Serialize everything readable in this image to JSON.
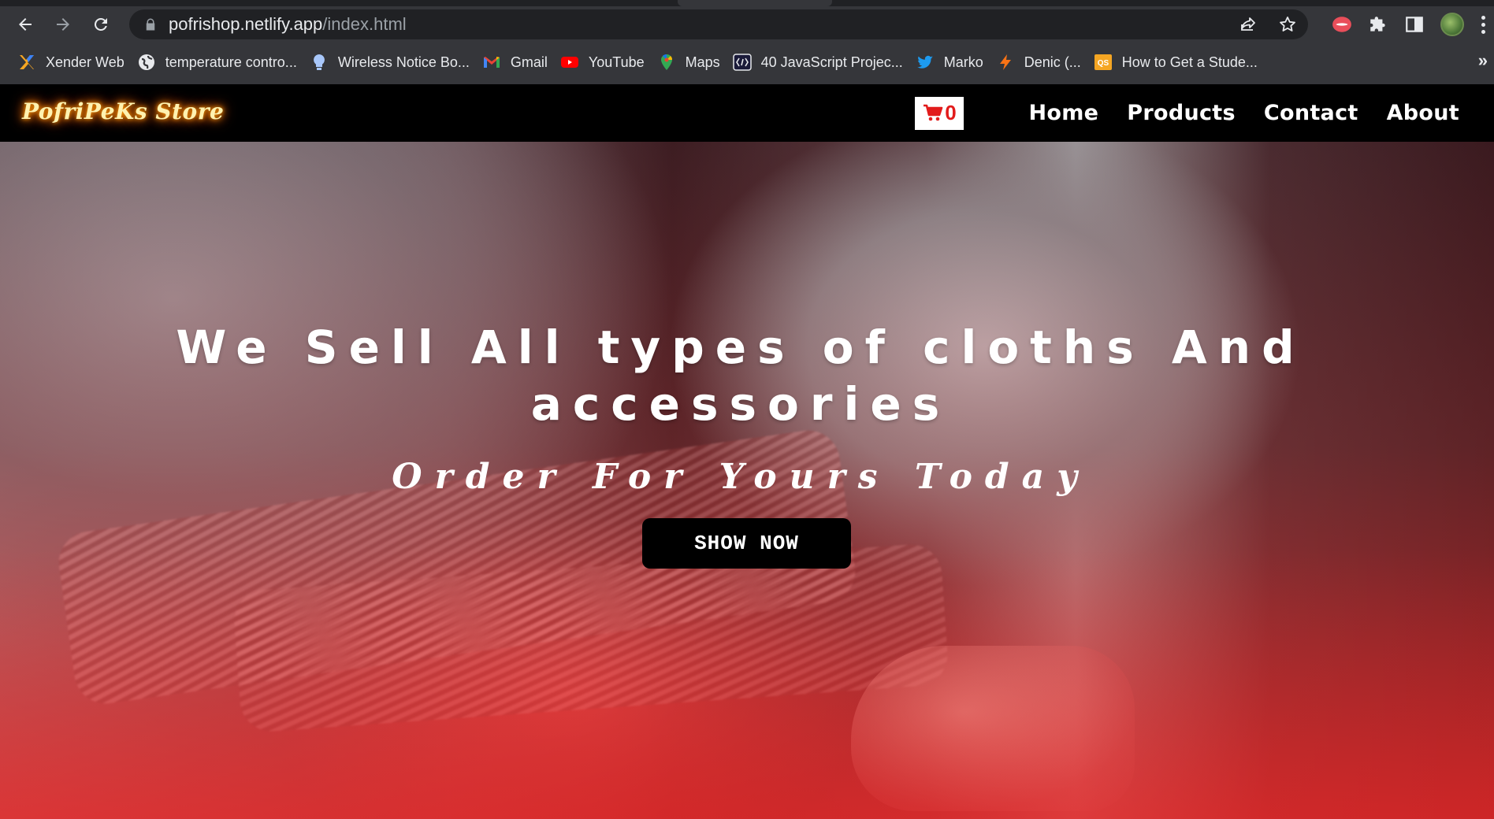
{
  "browser": {
    "url_host": "pofrishop.netlify.app",
    "url_path": "/index.html",
    "bookmarks": [
      {
        "label": "Xender Web",
        "icon": "xender-icon"
      },
      {
        "label": "temperature contro...",
        "icon": "globe-icon"
      },
      {
        "label": "Wireless Notice Bo...",
        "icon": "lightbulb-icon"
      },
      {
        "label": "Gmail",
        "icon": "gmail-icon"
      },
      {
        "label": "YouTube",
        "icon": "youtube-icon"
      },
      {
        "label": "Maps",
        "icon": "maps-icon"
      },
      {
        "label": "40 JavaScript Projec...",
        "icon": "code-icon"
      },
      {
        "label": "Marko",
        "icon": "twitter-icon"
      },
      {
        "label": "Denic (...",
        "icon": "bolt-icon"
      },
      {
        "label": "How to Get a Stude...",
        "icon": "qs-icon"
      }
    ],
    "overflow_label": "»"
  },
  "site": {
    "logo": "PofriPeKs Store",
    "cart_count": "0",
    "nav": {
      "home": "Home",
      "products": "Products",
      "contact": "Contact",
      "about": "About"
    }
  },
  "hero": {
    "title": "We Sell All types of cloths And accessories",
    "subtitle": "Order For Yours Today",
    "button": "SHOW NOW"
  },
  "colors": {
    "nav_bg": "#000000",
    "cart_count": "#e21b1b",
    "hero_overlay": "#e62828",
    "button_bg": "#000000"
  }
}
